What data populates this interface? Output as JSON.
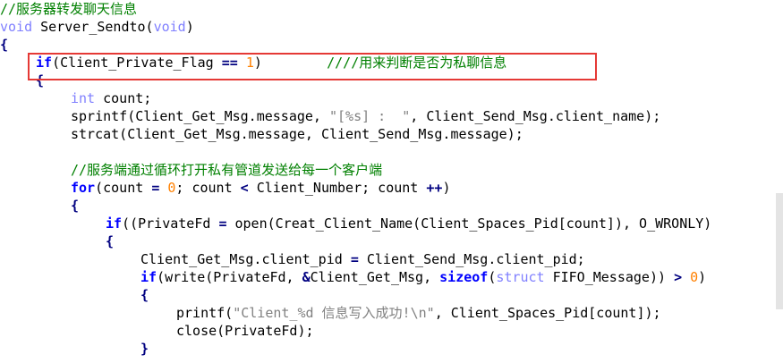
{
  "editor": {
    "comment_header": "//服务器转发聊天信息",
    "l2_type": "void",
    "l2_func": " Server_Sendto(",
    "l2_arg": "void",
    "l2_end": ")",
    "l3": "{",
    "l4_kw": "if",
    "l4_a": "(Client_Private_Flag ",
    "l4_op": "==",
    "l4_sp": " ",
    "l4_num": "1",
    "l4_b": ")        ",
    "l4_cmt": "////用来判断是否为私聊信息",
    "l5": "{",
    "l6_type": "int",
    "l6_rest": " count;",
    "l7_a": "sprintf(Client_Get_Msg.message, ",
    "l7_str": "\"[%s] :  \"",
    "l7_b": ", Client_Send_Msg.client_name);",
    "l8": "strcat(Client_Get_Msg.message, Client_Send_Msg.message);",
    "l10_cmt": "//服务端通过循环打开私有管道发送给每一个客户端",
    "l11_kw": "for",
    "l11_a": "(count ",
    "l11_op1": "=",
    "l11_sp": " ",
    "l11_num": "0",
    "l11_b": "; count ",
    "l11_op2": "<",
    "l11_c": " Client_Number; count ",
    "l11_op3": "++",
    "l11_d": ")",
    "l12": "{",
    "l13_kw": "if",
    "l13_a": "((PrivateFd ",
    "l13_op": "=",
    "l13_b": " open(Creat_Client_Name(Client_Spaces_Pid[count]), O_WRONLY)",
    "l14": "{",
    "l15_a": "Client_Get_Msg.client_pid ",
    "l15_op": "=",
    "l15_b": " Client_Send_Msg.client_pid;",
    "l16_kw": "if",
    "l16_a": "(write(PrivateFd, ",
    "l16_op1": "&",
    "l16_b": "Client_Get_Msg, ",
    "l16_kw2": "sizeof",
    "l16_c": "(",
    "l16_type": "struct",
    "l16_d": " FIFO_Message)) ",
    "l16_op2": ">",
    "l16_sp": " ",
    "l16_num": "0",
    "l16_e": ")",
    "l17": "{",
    "l18_a": "printf(",
    "l18_str": "\"Client_%d 信息写入成功!\\n\"",
    "l18_b": ", Client_Spaces_Pid[count]);",
    "l19": "close(PrivateFd);",
    "l20": "}"
  },
  "colors": {
    "keyword": "#0000ff",
    "type": "#8080ff",
    "number": "#ff8000",
    "string": "#808080",
    "comment": "#008000",
    "highlight_box": "#e53935"
  }
}
